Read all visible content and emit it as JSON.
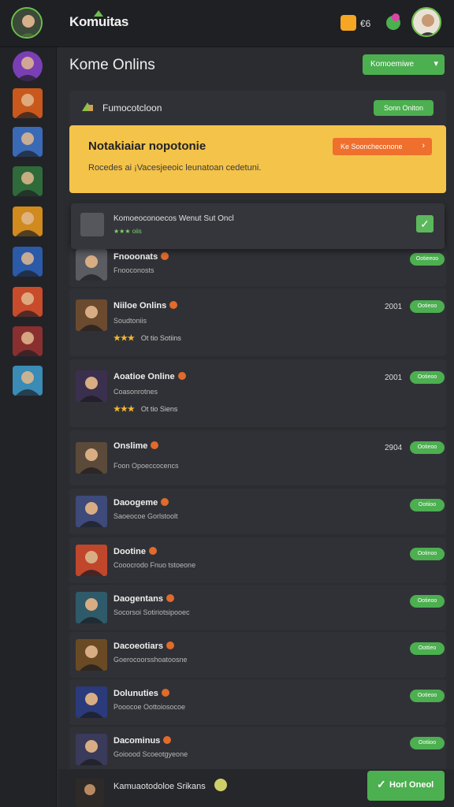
{
  "topbar": {
    "brand": "Komuitas",
    "notif_count": "€6",
    "left_avatar_icon": "user-avatar",
    "right_avatar_icon": "user-avatar",
    "chat_icon": "chat-bubble-icon"
  },
  "sidebar": {
    "items": [
      {
        "icon": "leaf-icon",
        "color": "#7a3fb5"
      },
      {
        "icon": "avatar-icon",
        "color": "#c9581c"
      },
      {
        "icon": "avatar-icon",
        "color": "#3a6ab6"
      },
      {
        "icon": "avatar-icon",
        "color": "#2f6a3a"
      },
      {
        "icon": "avatar-icon",
        "color": "#d08a1e"
      },
      {
        "icon": "avatar-icon",
        "color": "#2a5aa8"
      },
      {
        "icon": "avatar-icon",
        "color": "#c84b2b"
      },
      {
        "icon": "avatar-icon",
        "color": "#8a2f2f"
      },
      {
        "icon": "avatar-icon",
        "color": "#3a8bb5"
      }
    ]
  },
  "main": {
    "title": "Kome Onlins",
    "status_dropdown": "Komoemiwe",
    "section": {
      "title": "Fumocotcloon",
      "button": "Sonn Oniton"
    },
    "promo": {
      "title": "Notakiaiar nopotonie",
      "text": "Rocedes ai ¡Vacesjeeoic leunatoan cedetuni.",
      "button": "Ke Sooncheconone"
    },
    "selected": {
      "title": "Komoeoconoecos Wenut Sut Oncl",
      "sub": "★★★ oiis"
    },
    "rows": [
      {
        "name": "Fnooonats",
        "sub": "Fnooconosts",
        "stars": "",
        "stars_label": "",
        "year": "",
        "button": "Ootieeoo",
        "color": "#5a5c62"
      },
      {
        "name": "Niiloe Onlins",
        "sub": "Soudtoniis",
        "stars": "★★★",
        "stars_label": "Ot tio Sotiins",
        "year": "2001",
        "button": "Ootieoo",
        "color": "#6b4a2e"
      },
      {
        "name": "Aoatioe Online",
        "sub": "Coasonrotnes",
        "stars": "★★★",
        "stars_label": "Ot tio Siens",
        "year": "2001",
        "button": "Ootieoo",
        "color": "#3b2f4e"
      },
      {
        "name": "Onslime",
        "sub": "Foon Opoeccocencs",
        "stars": "",
        "stars_label": "",
        "year": "2904",
        "button": "Ootieoo",
        "color": "#5b4a3a"
      },
      {
        "name": "Daoogeme",
        "sub": "Saoeocoe Gorlstoolt",
        "stars": "",
        "stars_label": "",
        "year": "",
        "button": "Ootiioo",
        "color": "#3d4a7a"
      },
      {
        "name": "Dootine",
        "sub": "Cooocrodo Fnuo tstoeone",
        "stars": "",
        "stars_label": "",
        "year": "",
        "button": "Ootinoo",
        "color": "#c0462c"
      },
      {
        "name": "Daogentans",
        "sub": "Socorsoi Sotiriotsipooec",
        "stars": "",
        "stars_label": "",
        "year": "",
        "button": "Ootieoo",
        "color": "#2f5a6a"
      },
      {
        "name": "Dacoeotiars",
        "sub": "Goerocoorsshoatoosne",
        "stars": "",
        "stars_label": "",
        "year": "",
        "button": "Oottieo",
        "color": "#6a4a24"
      },
      {
        "name": "Dolunuties",
        "sub": "Pooocoe Oottoiosocoe",
        "stars": "",
        "stars_label": "",
        "year": "",
        "button": "Ootieoo",
        "color": "#2a3a7a"
      },
      {
        "name": "Dacominus",
        "sub": "Goioood Scoeotgyeone",
        "stars": "",
        "stars_label": "",
        "year": "",
        "button": "Ootiioo",
        "color": "#3a3a5a"
      }
    ]
  },
  "bottom": {
    "text": "Kamuaotodoloe Srikans",
    "button": "Horl Oneol"
  }
}
